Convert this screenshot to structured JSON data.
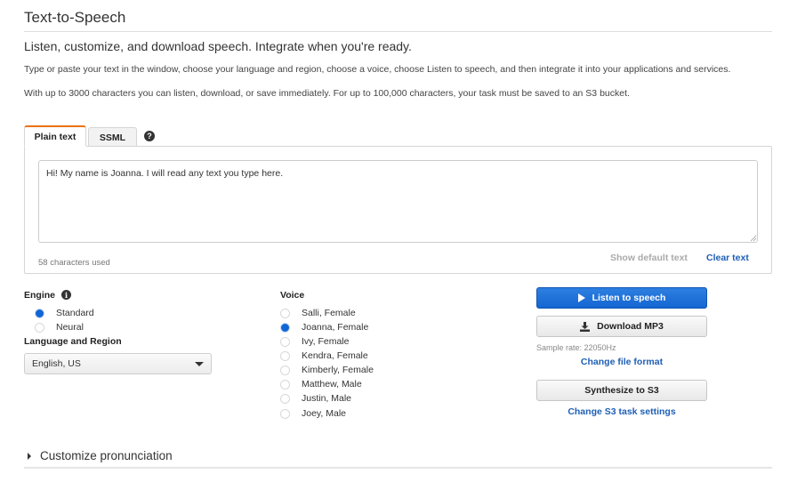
{
  "header": {
    "title": "Text-to-Speech",
    "subtitle": "Listen, customize, and download speech. Integrate when you're ready.",
    "description1": "Type or paste your text in the window, choose your language and region, choose a voice, choose Listen to speech, and then integrate it into your applications and services.",
    "description2": "With up to 3000 characters you can listen, download, or save immediately. For up to 100,000 characters, your task must be saved to an S3 bucket."
  },
  "tabs": [
    {
      "label": "Plain text",
      "active": true
    },
    {
      "label": "SSML",
      "active": false
    }
  ],
  "help_icon": "?",
  "editor": {
    "value": "Hi! My name is Joanna. I will read any text you type here.",
    "char_count": "58 characters used",
    "show_default_label": "Show default text",
    "clear_label": "Clear text"
  },
  "engine": {
    "label": "Engine",
    "info_icon": "i",
    "options": [
      {
        "label": "Standard",
        "checked": true
      },
      {
        "label": "Neural",
        "checked": false
      }
    ]
  },
  "language": {
    "label": "Language and Region",
    "selected": "English, US"
  },
  "voice": {
    "label": "Voice",
    "options": [
      {
        "label": "Salli, Female",
        "checked": false
      },
      {
        "label": "Joanna, Female",
        "checked": true
      },
      {
        "label": "Ivy, Female",
        "checked": false
      },
      {
        "label": "Kendra, Female",
        "checked": false
      },
      {
        "label": "Kimberly, Female",
        "checked": false
      },
      {
        "label": "Matthew, Male",
        "checked": false
      },
      {
        "label": "Justin, Male",
        "checked": false
      },
      {
        "label": "Joey, Male",
        "checked": false
      }
    ]
  },
  "actions": {
    "listen_label": "Listen to speech",
    "download_label": "Download MP3",
    "sample_rate": "Sample rate: 22050Hz",
    "change_format_label": "Change file format",
    "synthesize_label": "Synthesize to S3",
    "change_s3_label": "Change S3 task settings"
  },
  "customize": {
    "label": "Customize pronunciation"
  },
  "colors": {
    "accent_tab": "#ec7211",
    "primary_button": "#1466d2",
    "link": "#1f5fb5",
    "radio_checked": "#1166d6"
  }
}
